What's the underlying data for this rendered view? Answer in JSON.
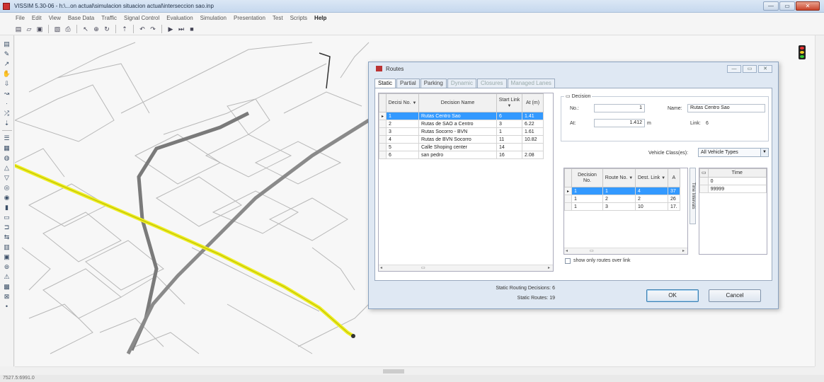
{
  "window": {
    "title": "VISSIM 5.30-06 - h:\\...on actual\\simulacion situacion actual\\interseccion sao.inp",
    "buttons": [
      "—",
      "▭",
      "✕"
    ]
  },
  "menu": [
    "File",
    "Edit",
    "View",
    "Base Data",
    "Traffic",
    "Signal Control",
    "Evaluation",
    "Simulation",
    "Presentation",
    "Test",
    "Scripts",
    "Help"
  ],
  "network": {
    "highlight_color": "#eeee22",
    "road_color": "#777777",
    "link_color": "#bbbbbb"
  },
  "status_bar": "7527.5:6991.0",
  "dialog": {
    "title": "Routes",
    "tabs": [
      {
        "label": "Static",
        "state": "active"
      },
      {
        "label": "Partial",
        "state": "normal"
      },
      {
        "label": "Parking",
        "state": "normal"
      },
      {
        "label": "Dynamic",
        "state": "disabled"
      },
      {
        "label": "Closures",
        "state": "disabled"
      },
      {
        "label": "Managed Lanes",
        "state": "disabled"
      }
    ],
    "decisions_grid": {
      "headers": [
        "Decisi No.",
        "Decision Name",
        "Start Link",
        "At (m)"
      ],
      "rows": [
        {
          "ind": "▸",
          "no": "1",
          "name": "Rutas Centro Sao",
          "link": "6",
          "at": "1.41",
          "selected": true
        },
        {
          "ind": "",
          "no": "2",
          "name": "Rutas de SAO a Centro",
          "link": "3",
          "at": "6.22",
          "selected": false
        },
        {
          "ind": "",
          "no": "3",
          "name": "Rutas Socorro - BVN",
          "link": "1",
          "at": "1.61",
          "selected": false
        },
        {
          "ind": "",
          "no": "4",
          "name": "Rutas de BVN Socorro",
          "link": "11",
          "at": "10.82",
          "selected": false
        },
        {
          "ind": "",
          "no": "5",
          "name": "Calle Shoping center",
          "link": "14",
          "at": "",
          "selected": false
        },
        {
          "ind": "",
          "no": "6",
          "name": "san pedro",
          "link": "16",
          "at": "2.08",
          "selected": false
        }
      ]
    },
    "decision": {
      "group_label": "Decision",
      "no_label": "No.:",
      "no_value": "1",
      "at_label": "At:",
      "at_value": "1.412",
      "at_unit": "m",
      "name_label": "Name:",
      "name_value": "Rutas Centro Sao",
      "link_label": "Link:",
      "link_value": "6",
      "vehicle_classes_label": "Vehicle Class(es):",
      "vehicle_classes_value": "All Vehicle Types"
    },
    "routes_grid": {
      "headers": [
        "Decision No.",
        "Route No.",
        "Dest. Link",
        "A"
      ],
      "rows": [
        {
          "ind": "▸",
          "decision": "1",
          "route": "1",
          "dest": "4",
          "at": "37",
          "selected": true
        },
        {
          "ind": "",
          "decision": "1",
          "route": "2",
          "dest": "2",
          "at": "26",
          "selected": false
        },
        {
          "ind": "",
          "decision": "1",
          "route": "3",
          "dest": "10",
          "at": "17.",
          "selected": false
        }
      ]
    },
    "time_tab_label": "Time Intervals",
    "time_grid": {
      "header": "Time",
      "rows": [
        "0",
        "99999"
      ]
    },
    "show_only_label": "show only routes over link",
    "summary": {
      "decisions_label": "Static Routing Decisions:",
      "decisions_value": "6",
      "routes_label": "Static Routes:",
      "routes_value": "19"
    },
    "ok_label": "OK",
    "cancel_label": "Cancel"
  }
}
